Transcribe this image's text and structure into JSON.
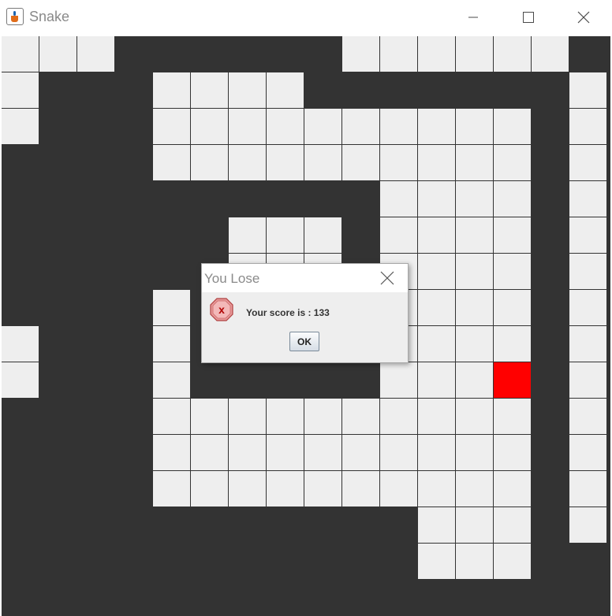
{
  "window": {
    "title": "Snake",
    "app_icon": "java-cup-icon",
    "controls": [
      "minimize-icon",
      "maximize-icon",
      "close-icon"
    ]
  },
  "game": {
    "grid_columns": 16,
    "grid_rows": 16,
    "colors": {
      "snake": "#333333",
      "empty": "#eeeeee",
      "food": "#ff0000"
    },
    "food_cell": [
      13,
      9
    ],
    "map": [
      "111000000111111",
      "1000111100000001",
      "1000111111111101",
      "0000111111111101",
      "0000000000111101",
      "0000001110111101",
      "0000001110111101",
      "0000101111111101",
      "1000100000111101",
      "1000100000111101",
      "0000111111111101",
      "0000111111111101",
      "0000111111111101",
      "0000000000011101",
      "0000000000011100",
      "0000000000000000"
    ]
  },
  "dialog": {
    "title": "You Lose",
    "icon": "error-icon",
    "message": "Your score is : 133",
    "ok_label": "OK"
  }
}
